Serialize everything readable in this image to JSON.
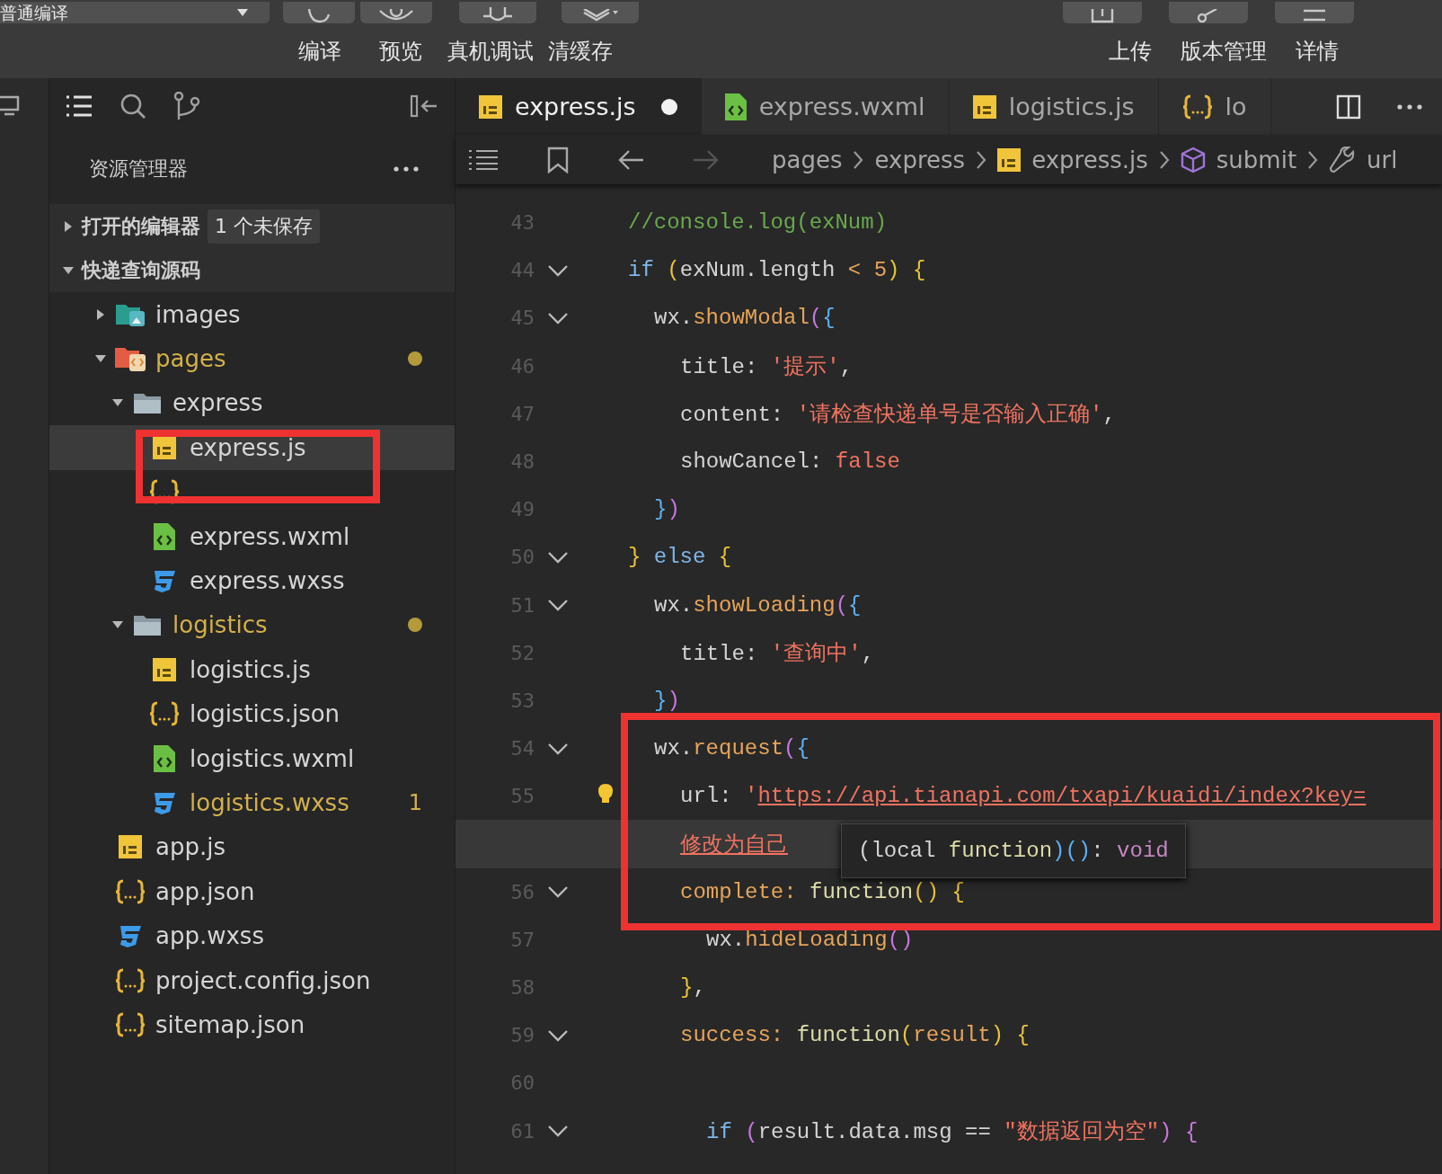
{
  "toolbar": {
    "mode_dropdown": "普通编译",
    "left_buttons": [
      {
        "label": "编译"
      },
      {
        "label": "预览"
      },
      {
        "label": "真机调试"
      },
      {
        "label": "清缓存"
      }
    ],
    "right_buttons": [
      {
        "label": "上传"
      },
      {
        "label": "版本管理"
      },
      {
        "label": "详情"
      }
    ]
  },
  "explorer": {
    "title": "资源管理器",
    "sections": [
      {
        "label": "打开的编辑器",
        "expanded": false,
        "badge": "1 个未保存"
      },
      {
        "label": "快递查询源码",
        "expanded": true,
        "items": [
          {
            "name": "images",
            "kind": "images-folder",
            "expanded": false,
            "modified": false,
            "selected": false
          },
          {
            "name": "pages",
            "kind": "pages-folder",
            "expanded": true,
            "modified": true,
            "selected": false,
            "children": [
              {
                "name": "express",
                "kind": "folder",
                "expanded": true,
                "modified": false,
                "selected": false,
                "children": [
                  {
                    "name": "express.js",
                    "kind": "js",
                    "modified": false,
                    "selected": true
                  },
                  {
                    "kind": "json",
                    "selected": false
                  },
                  {
                    "name": "express.wxml",
                    "kind": "wxml",
                    "modified": false,
                    "selected": false
                  },
                  {
                    "name": "express.wxss",
                    "kind": "wxss",
                    "modified": false,
                    "selected": false
                  }
                ]
              },
              {
                "name": "logistics",
                "kind": "folder",
                "expanded": true,
                "modified": true,
                "selected": false,
                "children": [
                  {
                    "name": "logistics.js",
                    "kind": "js",
                    "modified": false,
                    "selected": false
                  },
                  {
                    "name": "logistics.json",
                    "kind": "json",
                    "modified": false,
                    "selected": false
                  },
                  {
                    "name": "logistics.wxml",
                    "kind": "wxml",
                    "modified": false,
                    "selected": false
                  },
                  {
                    "name": "logistics.wxss",
                    "kind": "wxss",
                    "modified": true,
                    "selected": false,
                    "count": "1"
                  }
                ]
              }
            ]
          },
          {
            "name": "app.js",
            "kind": "js",
            "modified": false,
            "selected": false
          },
          {
            "name": "app.json",
            "kind": "json",
            "modified": false,
            "selected": false
          },
          {
            "name": "app.wxss",
            "kind": "wxss",
            "modified": false,
            "selected": false
          },
          {
            "name": "project.config.json",
            "kind": "json",
            "modified": false,
            "selected": false
          },
          {
            "name": "sitemap.json",
            "kind": "json",
            "modified": false,
            "selected": false
          }
        ]
      }
    ]
  },
  "tabs": [
    {
      "label": "express.js",
      "kind": "js",
      "selected": true,
      "dirty": true
    },
    {
      "label": "express.wxml",
      "kind": "wxml",
      "selected": false,
      "dirty": false
    },
    {
      "label": "logistics.js",
      "kind": "js",
      "selected": false,
      "dirty": false
    },
    {
      "label": "lo",
      "kind": "json",
      "selected": false,
      "dirty": false
    }
  ],
  "breadcrumb": [
    {
      "label": "pages",
      "kind": "folder"
    },
    {
      "label": "express",
      "kind": "folder"
    },
    {
      "label": "express.js",
      "kind": "js"
    },
    {
      "label": "submit",
      "kind": "method"
    },
    {
      "label": "url",
      "kind": "property"
    }
  ],
  "code": [
    {
      "number": "43",
      "tokens": [
        {
          "kind": "cmt",
          "text": "//console.log(exNum)"
        }
      ]
    },
    {
      "number": "44",
      "fold": true,
      "tokens": [
        {
          "kind": "kw",
          "text": "if"
        },
        {
          "kind": "b1",
          "text": " ("
        },
        {
          "kind": "plain",
          "text": "exNum.length "
        },
        {
          "kind": "op",
          "text": "<"
        },
        {
          "kind": "num",
          "text": " 5"
        },
        {
          "kind": "b1",
          "text": ")"
        },
        {
          "kind": "b1",
          "text": " {"
        }
      ],
      "children": [
        {
          "number": "45",
          "fold": true,
          "tokens": [
            {
              "kind": "plain",
              "text": "wx."
            },
            {
              "kind": "fn",
              "text": "showModal"
            },
            {
              "kind": "b2",
              "text": "("
            },
            {
              "kind": "b3",
              "text": "{"
            }
          ],
          "children": [
            {
              "number": "46",
              "tokens": [
                {
                  "kind": "plain",
                  "text": "title: "
                },
                {
                  "kind": "str",
                  "text": "'提示'"
                },
                {
                  "kind": "plain",
                  "text": ","
                }
              ]
            },
            {
              "number": "47",
              "tokens": [
                {
                  "kind": "plain",
                  "text": "content: "
                },
                {
                  "kind": "str",
                  "text": "'请检查快递单号是否输入正确'"
                },
                {
                  "kind": "plain",
                  "text": ","
                }
              ]
            },
            {
              "number": "48",
              "tokens": [
                {
                  "kind": "plain",
                  "text": "showCancel: "
                },
                {
                  "kind": "str",
                  "text": "false"
                }
              ]
            }
          ]
        },
        {
          "number": "49",
          "tokens": [
            {
              "kind": "b3",
              "text": "}"
            },
            {
              "kind": "b2",
              "text": ")"
            }
          ]
        }
      ]
    },
    {
      "number": "50",
      "fold": true,
      "tokens": [
        {
          "kind": "b1",
          "text": "}"
        },
        {
          "kind": "kw",
          "text": " else"
        },
        {
          "kind": "b1",
          "text": " {"
        }
      ],
      "children": [
        {
          "number": "51",
          "fold": true,
          "tokens": [
            {
              "kind": "plain",
              "text": "wx."
            },
            {
              "kind": "fn",
              "text": "showLoading"
            },
            {
              "kind": "b2",
              "text": "("
            },
            {
              "kind": "b3",
              "text": "{"
            }
          ],
          "children": [
            {
              "number": "52",
              "tokens": [
                {
                  "kind": "plain",
                  "text": "title: "
                },
                {
                  "kind": "str",
                  "text": "'查询中'"
                },
                {
                  "kind": "plain",
                  "text": ","
                }
              ]
            }
          ]
        },
        {
          "number": "53",
          "tokens": [
            {
              "kind": "b3",
              "text": "}"
            },
            {
              "kind": "b2",
              "text": ")"
            }
          ]
        },
        {
          "number": "54",
          "fold": true,
          "tokens": [
            {
              "kind": "plain",
              "text": "wx."
            },
            {
              "kind": "fn",
              "text": "request"
            },
            {
              "kind": "b2",
              "text": "("
            },
            {
              "kind": "b3",
              "text": "{"
            }
          ],
          "children": [
            {
              "number": "55",
              "lightbulb": true,
              "tokens": [
                {
                  "kind": "plain",
                  "text": "url: "
                },
                {
                  "kind": "str",
                  "text": "'"
                },
                {
                  "kind": "url",
                  "text": "https://api.tianapi.com/txapi/kuaidi/index?key="
                }
              ]
            },
            {
              "current": true,
              "tokens": [
                {
                  "kind": "url",
                  "text": "修改为自己"
                }
              ]
            },
            {
              "number": "56",
              "fold": true,
              "tokens": [
                {
                  "kind": "prop",
                  "text": "complete: "
                },
                {
                  "kind": "fnkw",
                  "text": "function"
                },
                {
                  "kind": "b1",
                  "text": "()"
                },
                {
                  "kind": "b1",
                  "text": " {"
                }
              ],
              "children": [
                {
                  "number": "57",
                  "tokens": [
                    {
                      "kind": "plain",
                      "text": "wx."
                    },
                    {
                      "kind": "fn",
                      "text": "hideLoading"
                    },
                    {
                      "kind": "b2",
                      "text": "()"
                    }
                  ]
                }
              ]
            },
            {
              "number": "58",
              "tokens": [
                {
                  "kind": "b1",
                  "text": "}"
                },
                {
                  "kind": "plain",
                  "text": ","
                }
              ]
            },
            {
              "number": "59",
              "fold": true,
              "tokens": [
                {
                  "kind": "prop",
                  "text": "success: "
                },
                {
                  "kind": "fnkw",
                  "text": "function"
                },
                {
                  "kind": "b1",
                  "text": "("
                },
                {
                  "kind": "prop",
                  "text": "result"
                },
                {
                  "kind": "b1",
                  "text": ")"
                },
                {
                  "kind": "b1",
                  "text": " {"
                }
              ],
              "children": [
                {
                  "number": "60"
                },
                {
                  "number": "61",
                  "fold": true,
                  "tokens": [
                    {
                      "kind": "kw",
                      "text": "if"
                    },
                    {
                      "kind": "b2",
                      "text": " ("
                    },
                    {
                      "kind": "plain",
                      "text": "result.data.msg == "
                    },
                    {
                      "kind": "str",
                      "text": "\"数据返回为空\""
                    },
                    {
                      "kind": "b2",
                      "text": ")"
                    },
                    {
                      "kind": "b2",
                      "text": " {"
                    }
                  ]
                }
              ]
            }
          ]
        }
      ]
    }
  ],
  "hover_tooltip": {
    "tokens": [
      {
        "kind": "plain",
        "text": "(local "
      },
      {
        "kind": "fnkw",
        "text": "function"
      },
      {
        "kind": "b3",
        "text": ")()"
      },
      {
        "kind": "plain",
        "text": ": "
      },
      {
        "kind": "type",
        "text": "void"
      }
    ]
  }
}
